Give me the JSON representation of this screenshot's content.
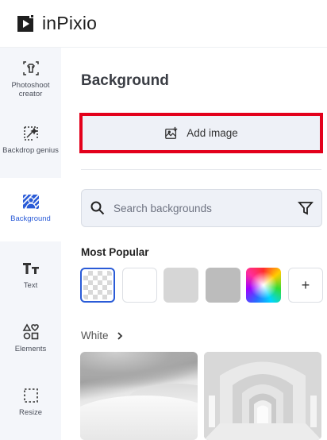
{
  "app": {
    "name": "inPixio"
  },
  "sidebar": {
    "items": [
      {
        "label": "Photoshoot creator",
        "icon": "photoshoot-icon"
      },
      {
        "label": "Backdrop genius",
        "icon": "magic-wand-icon"
      },
      {
        "label": "Background",
        "icon": "background-icon",
        "active": true
      },
      {
        "label": "Text",
        "icon": "text-icon"
      },
      {
        "label": "Elements",
        "icon": "shapes-icon"
      },
      {
        "label": "Resize",
        "icon": "resize-icon"
      }
    ]
  },
  "panel": {
    "title": "Background",
    "add_image_label": "Add image",
    "search": {
      "placeholder": "Search backgrounds"
    },
    "most_popular_title": "Most Popular",
    "swatches": [
      {
        "name": "transparent",
        "selected": true
      },
      {
        "name": "white",
        "color": "#ffffff"
      },
      {
        "name": "light-gray",
        "color": "#d6d6d6"
      },
      {
        "name": "gray",
        "color": "#bcbcbc"
      },
      {
        "name": "color-picker"
      },
      {
        "name": "add-color",
        "label": "+"
      }
    ],
    "white_category_label": "White"
  },
  "colors": {
    "accent": "#2a5bd7",
    "highlight": "#e3001b",
    "panel_bg": "#eef1f7"
  }
}
